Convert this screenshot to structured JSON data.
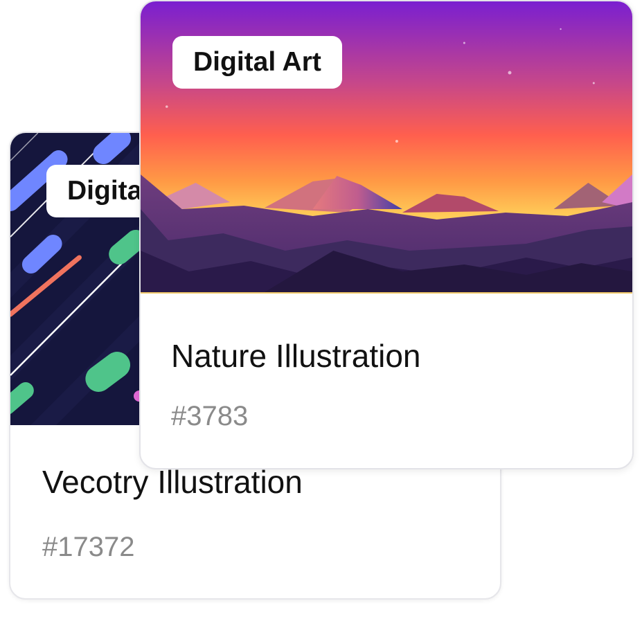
{
  "cards": [
    {
      "tag": "Digital Art",
      "title": "Vecotry Illustration",
      "id": "#17372",
      "image": "abstract-streaks-artwork"
    },
    {
      "tag": "Digital Art",
      "title": "Nature Illustration",
      "id": "#3783",
      "image": "mountain-sunset-artwork"
    }
  ],
  "colors": {
    "card_background": "#ffffff",
    "title_text": "#111111",
    "id_text": "#8a8a8a",
    "back_art_background": "#15163d",
    "sunset_top": "#7a1fd0",
    "sunset_middle": "#ff5f4e",
    "sunset_horizon": "#ffd15a",
    "mountain_dark": "#2a1a4a"
  }
}
